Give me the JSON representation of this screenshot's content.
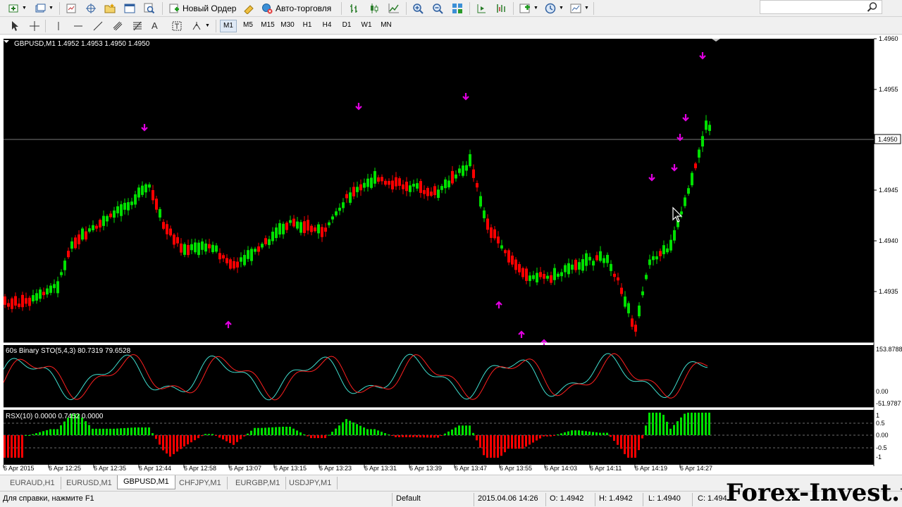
{
  "toolbar": {
    "new_order_label": "Новый Ордер",
    "autotrading_label": "Авто-торговля",
    "timeframes": [
      "M1",
      "M5",
      "M15",
      "M30",
      "H1",
      "H4",
      "D1",
      "W1",
      "MN"
    ],
    "active_timeframe": "M1"
  },
  "chart": {
    "main_label": "GBPUSD,M1  1.4952 1.4953 1.4950 1.4950",
    "price_ticks": [
      "1.4960",
      "1.4955",
      "1.4950",
      "1.4945",
      "1.4940",
      "1.4935"
    ],
    "current_price": "1.4950",
    "time_labels": [
      "6 Apr 2015",
      "6 Apr 12:25",
      "6 Apr 12:35",
      "6 Apr 12:44",
      "6 Apr 12:58",
      "6 Apr 13:07",
      "6 Apr 13:15",
      "6 Apr 13:23",
      "6 Apr 13:31",
      "6 Apr 13:39",
      "6 Apr 13:47",
      "6 Apr 13:55",
      "6 Apr 14:03",
      "6 Apr 14:11",
      "6 Apr 14:19",
      "6 Apr 14:27"
    ],
    "colors": {
      "bull": "#00e000",
      "bear": "#ff0000",
      "arrow": "#e000e0",
      "background": "#000000",
      "stoch_main": "#40e0d0",
      "stoch_signal": "#ff2020"
    }
  },
  "sto": {
    "label": "60s Binary STO(5,4,3) 80.7319 79.6528",
    "ticks": [
      "153.8788",
      "0.00",
      "-51.9787"
    ]
  },
  "rsx": {
    "label": "RSX(10) 0.0000 0.7452 0.0000",
    "ticks": [
      "1",
      "0.5",
      "0.00",
      "-0.5",
      "-1"
    ]
  },
  "tabs": [
    "EURAUD,H1",
    "EURUSD,M1",
    "GBPUSD,M1",
    "CHFJPY,M1",
    "EURGBP,M1",
    "USDJPY,M1"
  ],
  "active_tab": "GBPUSD,M1",
  "status": {
    "help": "Для справки, нажмите F1",
    "profile": "Default",
    "datetime": "2015.04.06 14:26",
    "open": "O: 1.4942",
    "high": "H: 1.4942",
    "low": "L: 1.4940",
    "close": "C: 1.494"
  },
  "watermark": "Forex-Invest.tv"
}
